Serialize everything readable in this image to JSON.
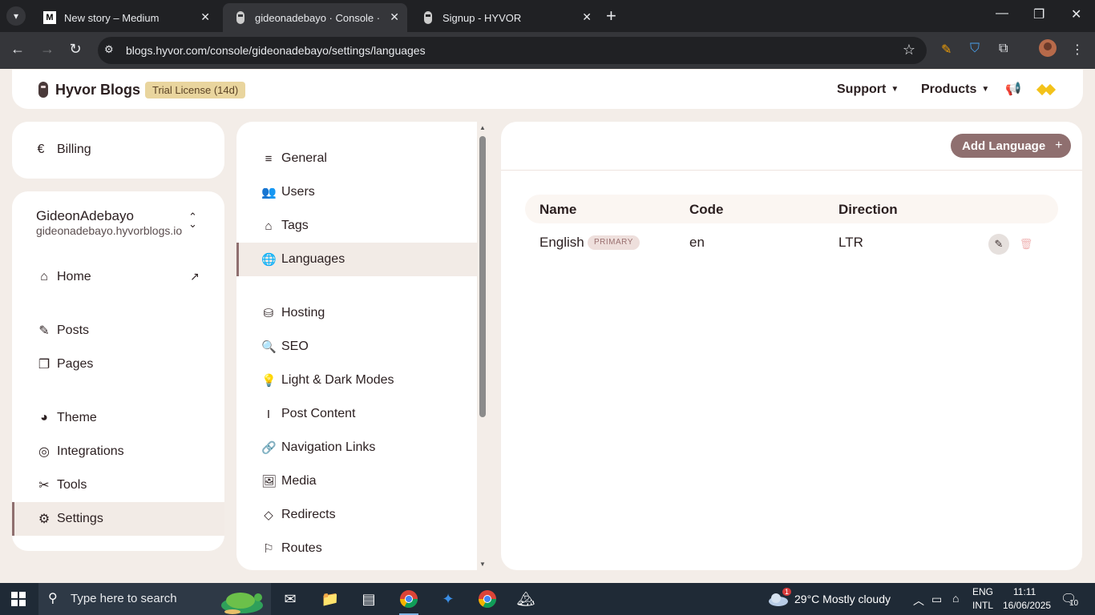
{
  "browser": {
    "tabs": [
      {
        "favicon": "M",
        "title": "New story – Medium",
        "active": false
      },
      {
        "favicon": "",
        "title": "gideonadebayo · Console · Hyvor",
        "active": true
      },
      {
        "favicon": "",
        "title": "Signup - HYVOR",
        "active": false
      }
    ],
    "url": "blogs.hyvor.com/console/gideonadebayo/settings/languages"
  },
  "header": {
    "brand": "Hyvor Blogs",
    "trial_badge": "Trial License (14d)",
    "menu_support": "Support",
    "menu_products": "Products"
  },
  "sidebar": {
    "billing": "Billing",
    "workspace_name": "GideonAdebayo",
    "workspace_url": "gideonadebayo.hyvorblogs.io",
    "items": [
      {
        "label": "Home",
        "icon": "home-icon"
      },
      {
        "label": "Posts",
        "icon": "pencil-icon"
      },
      {
        "label": "Pages",
        "icon": "pages-icon"
      },
      {
        "label": "Theme",
        "icon": "palette-icon"
      },
      {
        "label": "Integrations",
        "icon": "integrations-icon"
      },
      {
        "label": "Tools",
        "icon": "tools-icon"
      },
      {
        "label": "Settings",
        "icon": "gear-icon"
      }
    ]
  },
  "settings_nav": {
    "items": [
      {
        "label": "General",
        "icon": "list-icon"
      },
      {
        "label": "Users",
        "icon": "users-icon"
      },
      {
        "label": "Tags",
        "icon": "tag-icon"
      },
      {
        "label": "Languages",
        "icon": "globe-icon"
      },
      {
        "label": "Hosting",
        "icon": "database-icon"
      },
      {
        "label": "SEO",
        "icon": "magnifier-icon"
      },
      {
        "label": "Light & Dark Modes",
        "icon": "lightbulb-icon"
      },
      {
        "label": "Post Content",
        "icon": "text-cursor-icon"
      },
      {
        "label": "Navigation Links",
        "icon": "link-icon"
      },
      {
        "label": "Media",
        "icon": "image-icon"
      },
      {
        "label": "Redirects",
        "icon": "redirect-icon"
      },
      {
        "label": "Routes",
        "icon": "signpost-icon"
      }
    ],
    "active": "Languages"
  },
  "languages": {
    "add_button": "Add Language",
    "columns": [
      "Name",
      "Code",
      "Direction"
    ],
    "rows": [
      {
        "name": "English",
        "badge": "PRIMARY",
        "code": "en",
        "direction": "LTR"
      }
    ]
  },
  "taskbar": {
    "search_placeholder": "Type here to search",
    "weather_alert": "1",
    "weather": "29°C  Mostly cloudy",
    "lang_line1": "ENG",
    "lang_line2": "INTL",
    "time": "11:11",
    "date": "16/06/2025",
    "notifications": "10"
  },
  "colors": {
    "accent": "#8f6f6f",
    "trial_badge_bg": "#e9d59e",
    "page_bg": "#f3ede8"
  }
}
